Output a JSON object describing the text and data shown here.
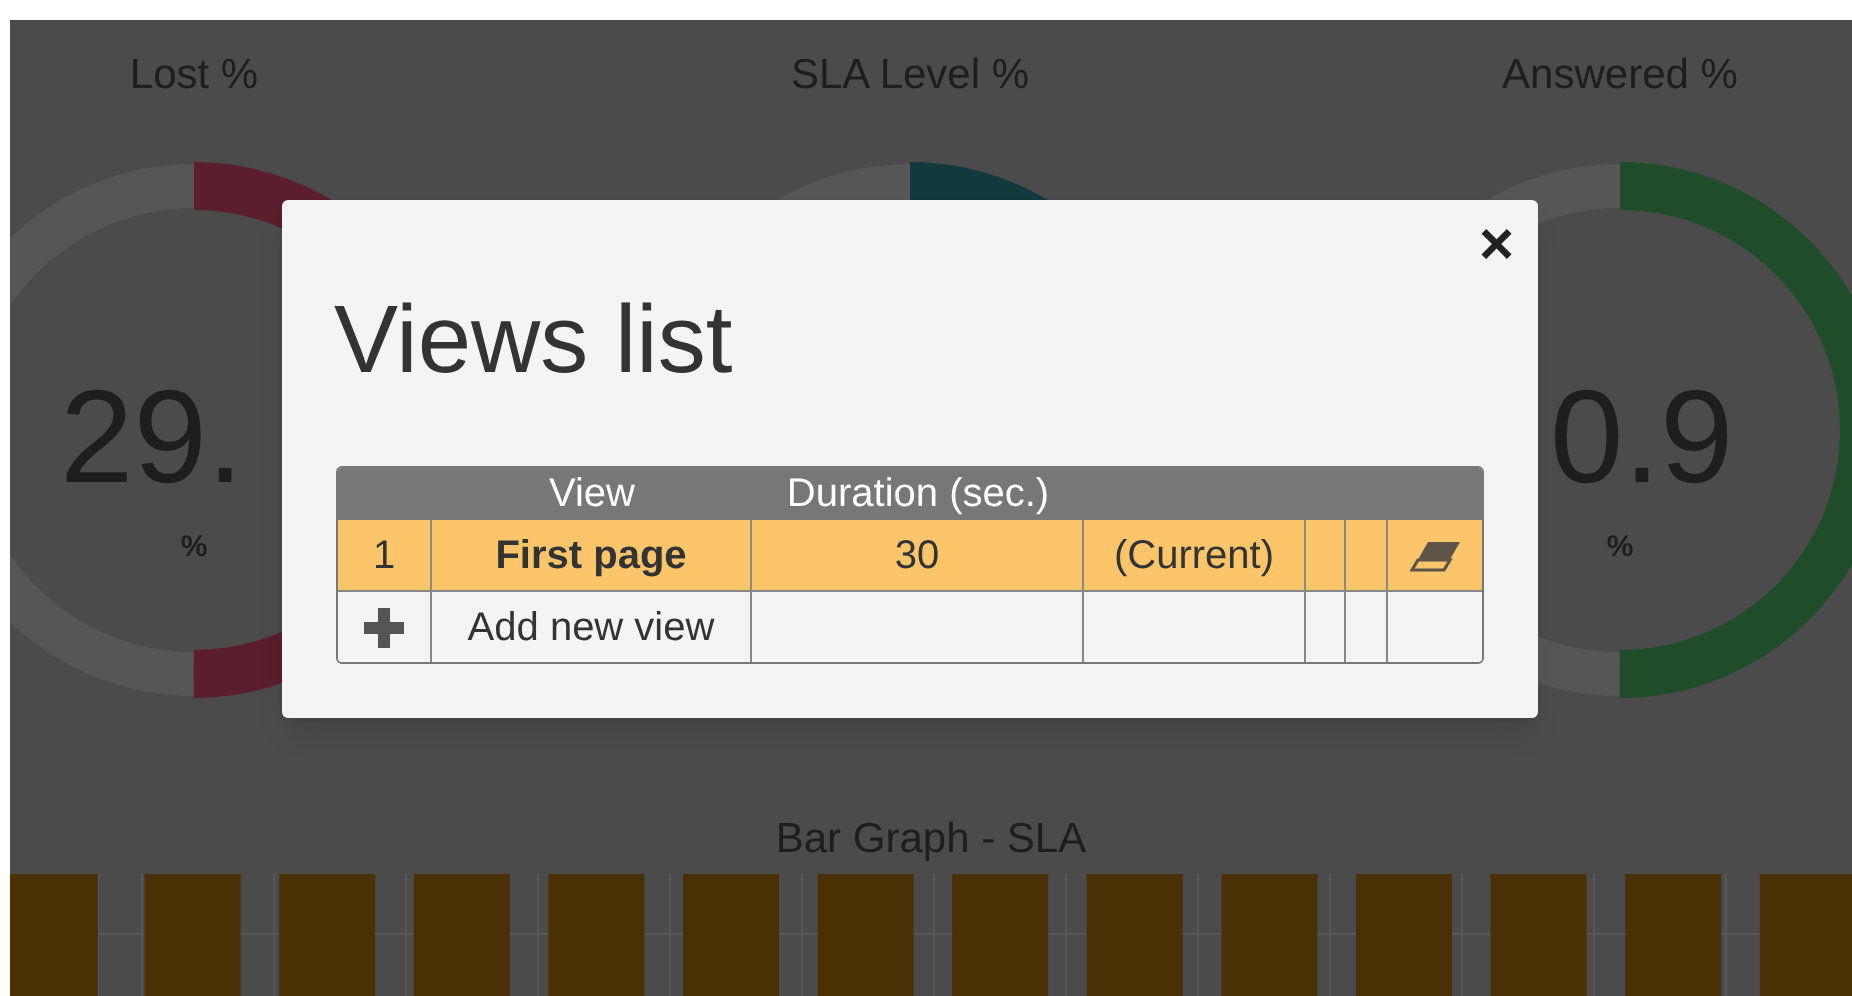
{
  "gauges": [
    {
      "title": "Lost %",
      "value": "29.",
      "unit": "%",
      "color": "#5a1e2e"
    },
    {
      "title": "SLA Level %",
      "color": "#12393c"
    },
    {
      "title": "Answered %",
      "value": "0.9",
      "unit": "%",
      "color": "#1f4d2a"
    }
  ],
  "bar_graph": {
    "title": "Bar Graph - SLA"
  },
  "dialog": {
    "title": "Views list",
    "close": "×",
    "columns": [
      "",
      "View",
      "Duration (sec.)",
      "",
      "",
      "",
      ""
    ],
    "rows": [
      {
        "index": "1",
        "view": "First page",
        "duration": "30",
        "status": "(Current)",
        "selected": true
      }
    ],
    "add_row": {
      "label": "Add new view"
    }
  }
}
